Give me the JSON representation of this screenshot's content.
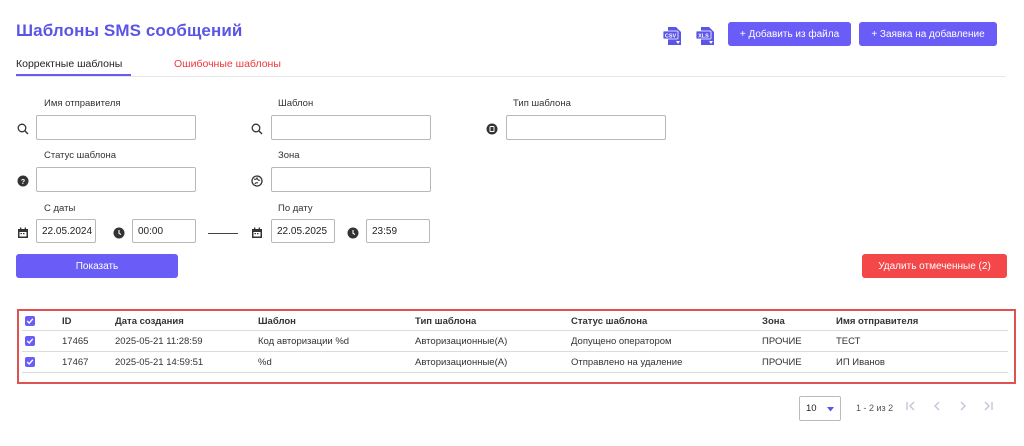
{
  "page": {
    "title": "Шаблоны SMS сообщений"
  },
  "toolbar": {
    "csv_label": "CSV",
    "xls_label": "XLS",
    "add_from_file": "+ Добавить из файла",
    "request_add": "+ Заявка на добавление"
  },
  "tabs": [
    {
      "label": "Корректные шаблоны",
      "active": true
    },
    {
      "label": "Ошибочные шаблоны",
      "active": false
    }
  ],
  "filters": {
    "sender_name": {
      "label": "Имя отправителя",
      "value": ""
    },
    "template": {
      "label": "Шаблон",
      "value": ""
    },
    "template_type": {
      "label": "Тип шаблона",
      "value": ""
    },
    "template_status": {
      "label": "Статус шаблона",
      "value": ""
    },
    "zone": {
      "label": "Зона",
      "value": ""
    },
    "date_from": {
      "label": "С даты",
      "date": "22.05.2024",
      "time": "00:00"
    },
    "date_to": {
      "label": "По дату",
      "date": "22.05.2025",
      "time": "23:59"
    }
  },
  "actions": {
    "show": "Показать",
    "delete_selected": "Удалить отмеченные (2)"
  },
  "table": {
    "columns": [
      "ID",
      "Дата создания",
      "Шаблон",
      "Тип шаблона",
      "Статус шаблона",
      "Зона",
      "Имя отправителя"
    ],
    "rows": [
      {
        "id": "17465",
        "created": "2025-05-21 11:28:59",
        "template": "Код авторизации %d",
        "type": "Авторизационные(A)",
        "status": "Допущено оператором",
        "zone": "ПРОЧИЕ",
        "sender": "ТЕСТ",
        "checked": true
      },
      {
        "id": "17467",
        "created": "2025-05-21 14:59:51",
        "template": "%d",
        "type": "Авторизационные(A)",
        "status": "Отправлено на удаление",
        "zone": "ПРОЧИЕ",
        "sender": "ИП Иванов",
        "checked": true
      }
    ]
  },
  "pagination": {
    "page_size": "10",
    "info": "1 - 2 из 2"
  },
  "colors": {
    "accent": "#6a5cf6",
    "danger": "#f4474a",
    "error_tab": "#f0353b",
    "table_border": "#e0524f"
  }
}
